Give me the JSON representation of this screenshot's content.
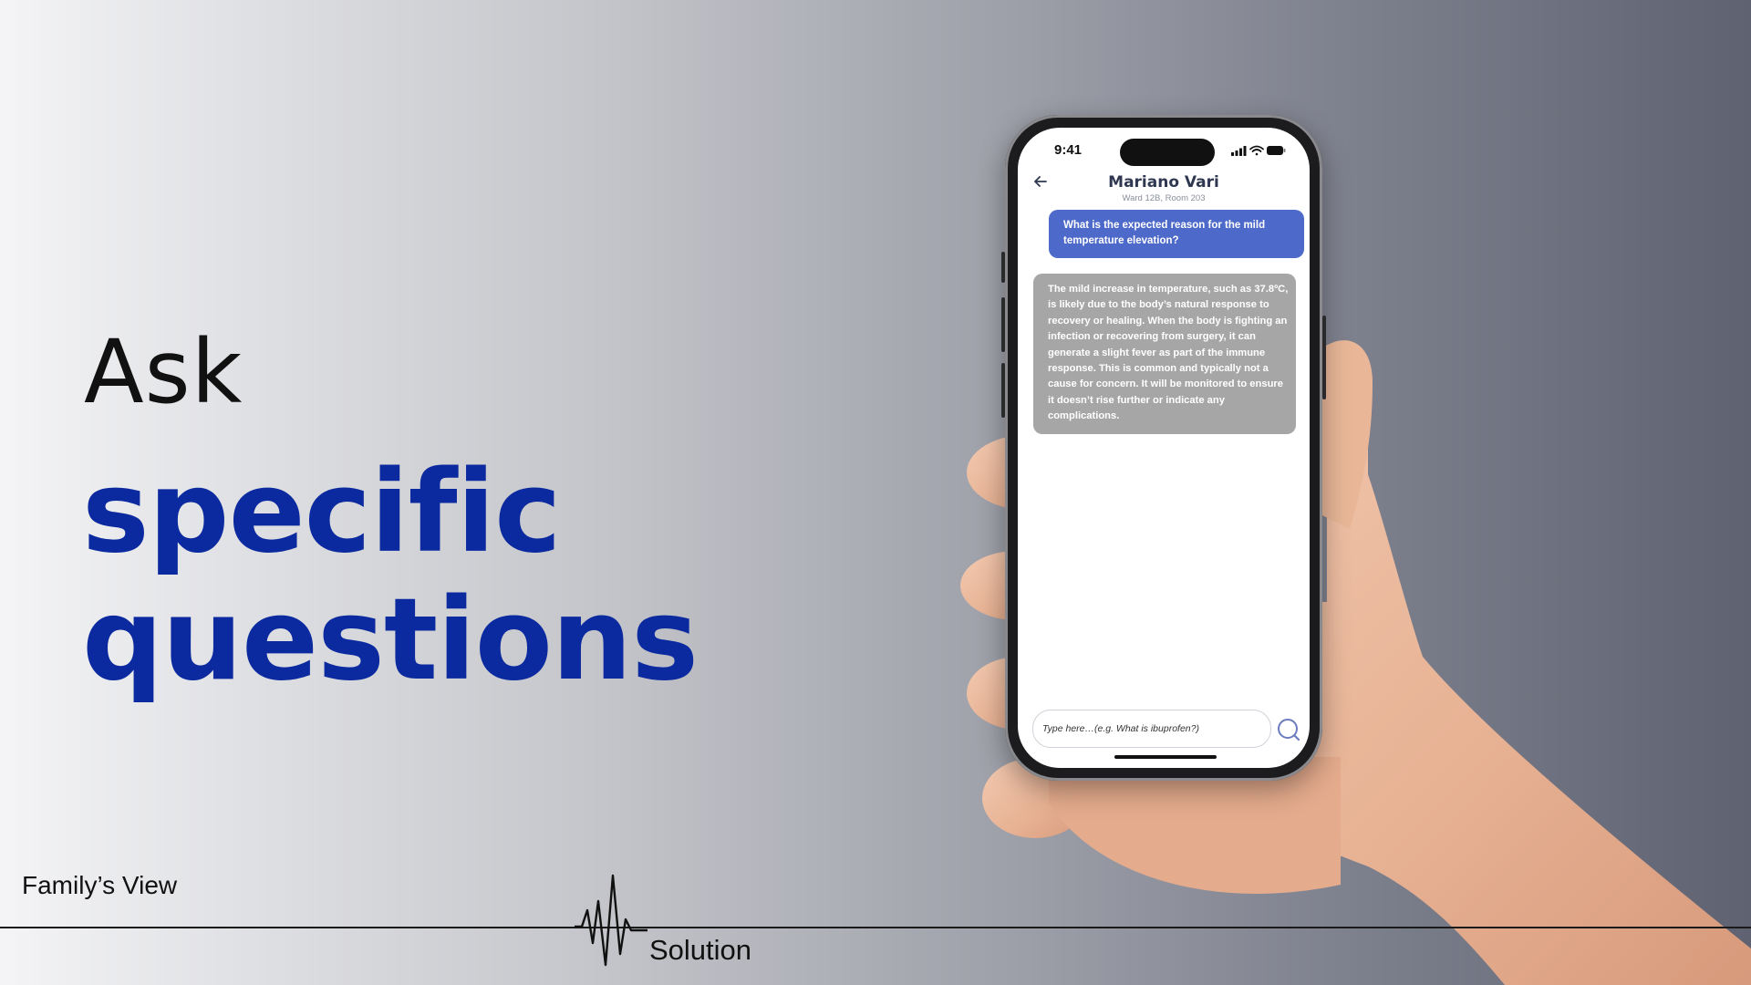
{
  "slide": {
    "headline_light": "Ask",
    "headline_strong_line1": "specific",
    "headline_strong_line2": "questions",
    "footer_left": "Family’s View",
    "footer_section": "Solution"
  },
  "phone": {
    "status_time": "9:41",
    "contact_name": "Mariano Vari",
    "contact_location": "Ward 12B, Room 203",
    "messages": [
      {
        "from": "user",
        "text": "What is the expected reason for the mild temperature elevation?"
      },
      {
        "from": "assistant",
        "text": "The mild increase in temperature, such as 37.8ºC, is likely due to the body’s natural response to recovery or healing. When the body is fighting an infection or recovering from surgery, it can generate a slight fever as part of the immune response. This is common and typically not a cause for concern. It will be monitored to ensure it doesn’t rise further or indicate any complications."
      }
    ],
    "input_placeholder": "Type here…(e.g. What is ibuprofen?)",
    "icons": {
      "back": "arrow-left-icon",
      "send": "search-icon",
      "status": [
        "signal-icon",
        "wifi-icon",
        "battery-icon"
      ]
    }
  },
  "colors": {
    "headline_blue": "#0b2a9f",
    "user_bubble": "#4d69c9",
    "assistant_bubble": "#a6a6a6"
  }
}
